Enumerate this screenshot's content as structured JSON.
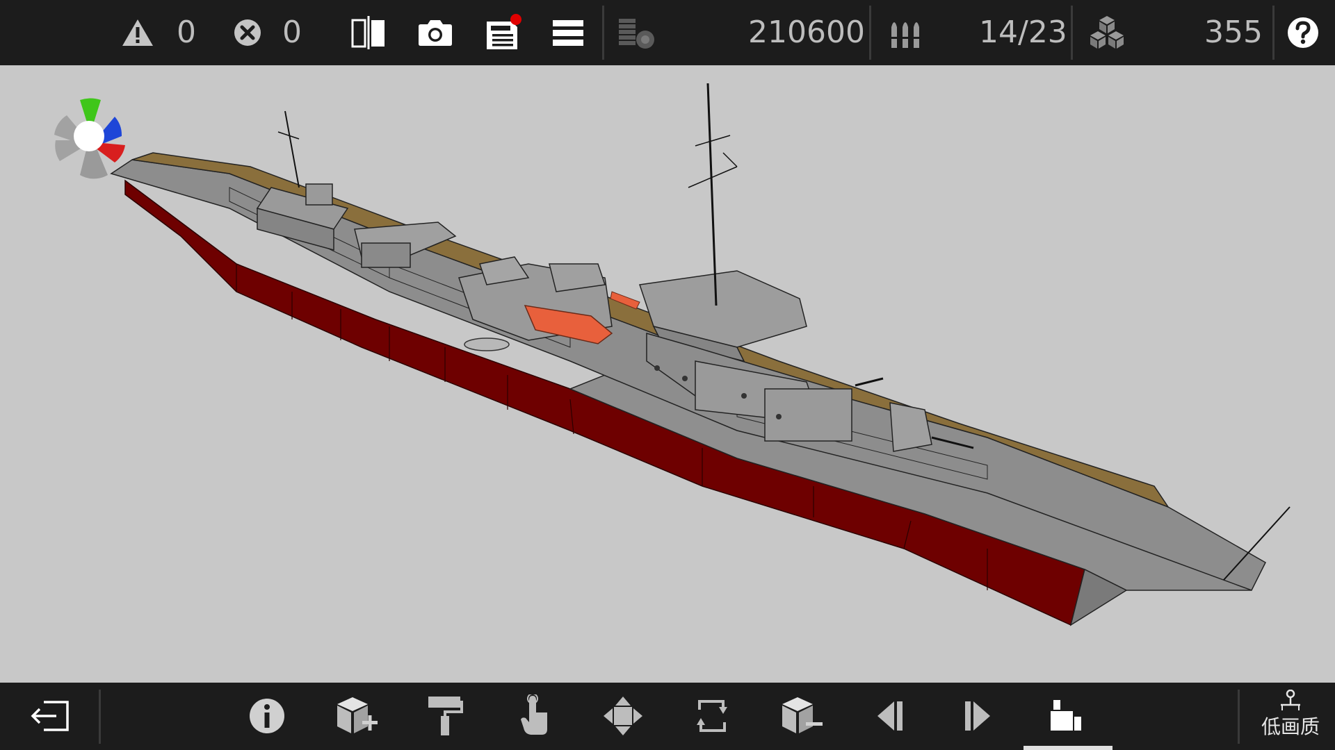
{
  "toolbar": {
    "warning_count": "0",
    "error_count": "0",
    "cost": "210600",
    "ammo": "14/23",
    "parts": "355"
  },
  "bottom": {
    "quality_label": "低画质"
  },
  "icons": {
    "warning": "warning-icon",
    "error": "error-icon",
    "mirror": "mirror-icon",
    "camera": "camera-icon",
    "save": "save-icon",
    "menu": "menu-icon",
    "coins": "coins-icon",
    "ammo": "ammo-icon",
    "parts": "parts-icon",
    "help": "help-icon",
    "exit": "exit-icon",
    "info": "info-icon",
    "add_block": "add-block-icon",
    "paint": "paint-roller-icon",
    "select": "hand-pointer-icon",
    "move": "move-icon",
    "rotate": "rotate-icon",
    "remove_block": "remove-block-icon",
    "prev": "previous-icon",
    "next": "next-icon",
    "factory": "factory-icon",
    "quality": "quality-icon"
  },
  "colors": {
    "hull_red": "#6e0000",
    "deck_tan": "#8a6f3c",
    "steel_gray": "#8d8d8d",
    "boat_orange": "#e8603c",
    "bar_bg": "#1c1c1c",
    "viewport_bg": "#c8c8c8"
  }
}
